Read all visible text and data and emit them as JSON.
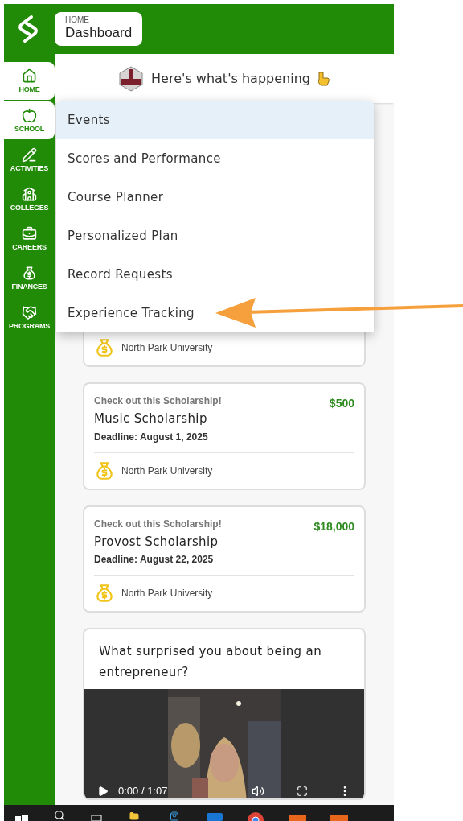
{
  "header": {
    "breadcrumb": "HOME",
    "title": "Dashboard"
  },
  "sidebar": {
    "items": [
      {
        "label": "HOME",
        "kind": "home",
        "highlighted": true
      },
      {
        "label": "SCHOOL",
        "kind": "school",
        "highlighted": true
      },
      {
        "label": "ACTIVITIES",
        "kind": "activities",
        "highlighted": false
      },
      {
        "label": "COLLEGES",
        "kind": "colleges",
        "highlighted": false
      },
      {
        "label": "CAREERS",
        "kind": "careers",
        "highlighted": false
      },
      {
        "label": "FINANCES",
        "kind": "finances",
        "highlighted": false
      },
      {
        "label": "PROGRAMS",
        "kind": "programs",
        "highlighted": false
      }
    ]
  },
  "feed_heading": "Here's what's happening",
  "menu": {
    "items": [
      {
        "label": "Events",
        "selected": true
      },
      {
        "label": "Scores and Performance",
        "selected": false
      },
      {
        "label": "Course Planner",
        "selected": false
      },
      {
        "label": "Personalized Plan",
        "selected": false
      },
      {
        "label": "Record Requests",
        "selected": false
      },
      {
        "label": "Experience Tracking",
        "selected": false
      }
    ]
  },
  "cards": [
    {
      "provider": "North Park University"
    },
    {
      "eyebrow": "Check out this Scholarship!",
      "amount": "$500",
      "title": "Music Scholarship",
      "deadline": "Deadline: August 1, 2025",
      "provider": "North Park University"
    },
    {
      "eyebrow": "Check out this Scholarship!",
      "amount": "$18,000",
      "title": "Provost Scholarship",
      "deadline": "Deadline: August 22, 2025",
      "provider": "North Park University"
    }
  ],
  "video_card": {
    "question": "What surprised you about being an entrepreneur?",
    "video": {
      "kind": "picture",
      "time": "0:00 / 1:07"
    }
  }
}
